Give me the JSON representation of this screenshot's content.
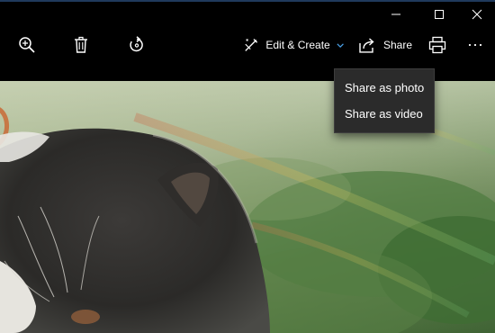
{
  "titlebar": {
    "minimize_icon": "minimize-icon",
    "maximize_icon": "maximize-icon",
    "close_icon": "close-icon"
  },
  "toolbar": {
    "zoom_icon": "zoom-in-icon",
    "delete_icon": "trash-icon",
    "rotate_icon": "rotate-icon",
    "edit_create_label": "Edit & Create",
    "share_label": "Share",
    "print_icon": "printer-icon",
    "more_icon": "more-icon"
  },
  "share_menu": {
    "items": [
      {
        "label": "Share as photo"
      },
      {
        "label": "Share as video"
      }
    ]
  },
  "colors": {
    "background": "#000000",
    "menu_background": "#2b2b2b",
    "accent_chevron": "#4aa0e8"
  }
}
